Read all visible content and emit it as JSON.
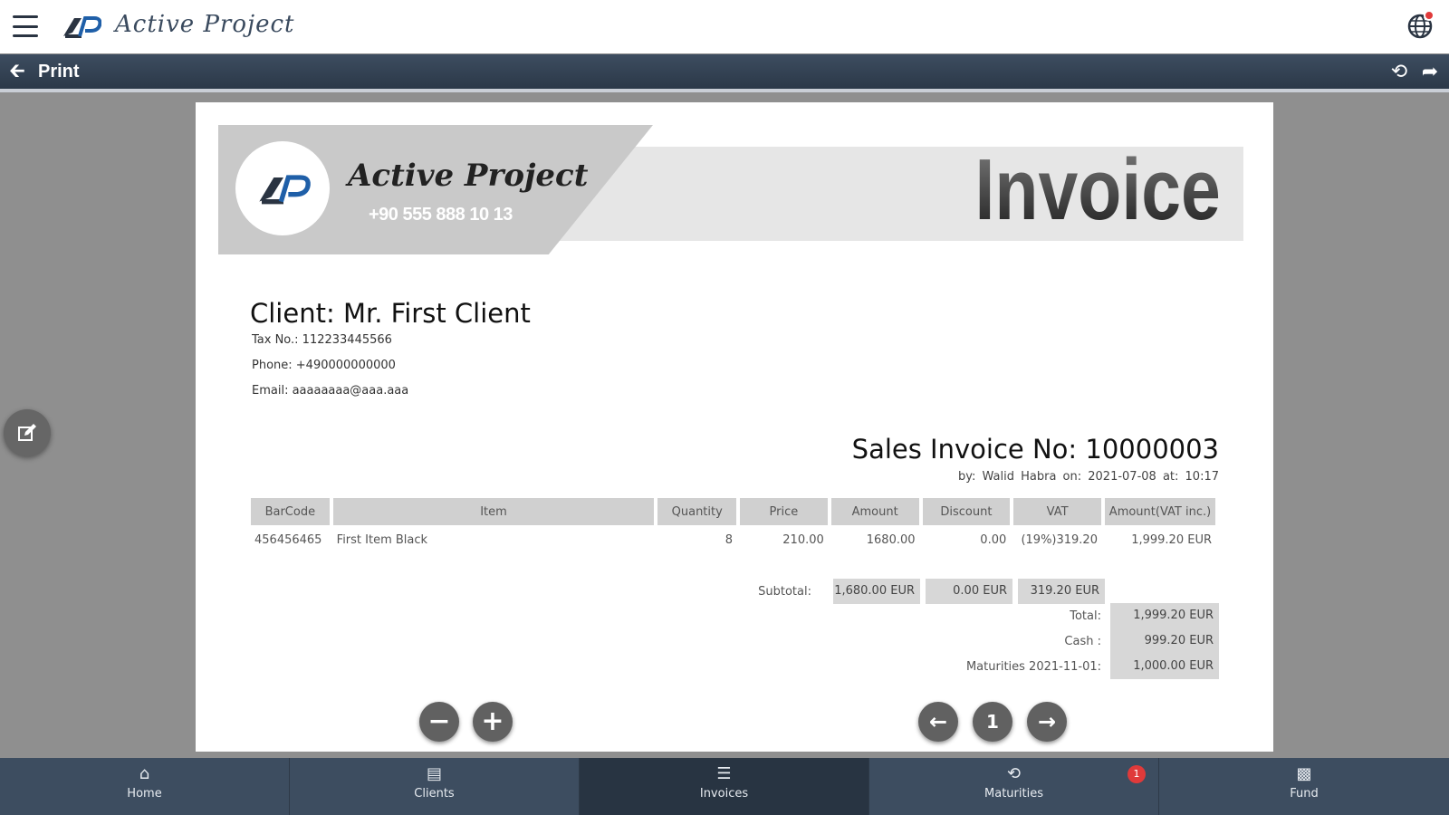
{
  "app": {
    "title": "Active Project",
    "menu_icon": "hamburger-icon",
    "logo_icon": "ap-logo-icon",
    "language_icon": "globe-icon"
  },
  "toolbar": {
    "title": "Print",
    "back_icon": "arrow-left-icon",
    "history_icon": "history-icon",
    "share_icon": "share-icon"
  },
  "invoice": {
    "company_name": "Active Project",
    "company_phone": "+90 555 888 10 13",
    "heading": "Invoice",
    "client": {
      "name": "Client: Mr. First Client",
      "tax": "Tax No.: 112233445566",
      "phone": "Phone: +490000000000",
      "email": "Email: aaaaaaaa@aaa.aaa"
    },
    "number": "Sales Invoice No: 10000003",
    "by_line": "by: Walid Habra  on: 2021-07-08  at: 10:17",
    "columns": [
      "BarCode",
      "Item",
      "Quantity",
      "Price",
      "Amount",
      "Discount",
      "VAT",
      "Amount(VAT inc.)"
    ],
    "rows": [
      [
        "456456465",
        "First Item Black",
        "8",
        "210.00",
        "1680.00",
        "0.00",
        "(19%)319.20",
        "1,999.20 EUR"
      ]
    ],
    "subtotal_label": "Subtotal:",
    "subtotals": [
      "1,680.00 EUR",
      "0.00 EUR",
      "319.20 EUR"
    ],
    "totals": [
      {
        "label": "Total:",
        "value": "1,999.20 EUR"
      },
      {
        "label": "Cash :",
        "value": "999.20 EUR"
      },
      {
        "label": "Maturities 2021-11-01:",
        "value": "1,000.00 EUR"
      }
    ]
  },
  "controls": {
    "zoom_out": "−",
    "zoom_in": "+",
    "prev": "←",
    "page": "1",
    "next": "→"
  },
  "nav": {
    "items": [
      {
        "label": "Home",
        "icon": "home-icon"
      },
      {
        "label": "Clients",
        "icon": "id-card-icon"
      },
      {
        "label": "Invoices",
        "icon": "list-icon"
      },
      {
        "label": "Maturities",
        "icon": "history-icon"
      },
      {
        "label": "Fund",
        "icon": "money-icon"
      }
    ],
    "maturities_badge": "1"
  },
  "colors": {
    "bar": "#3d4d60",
    "active_nav": "#283442",
    "badge": "#e03a3a",
    "table_header": "#d0d0d0"
  }
}
